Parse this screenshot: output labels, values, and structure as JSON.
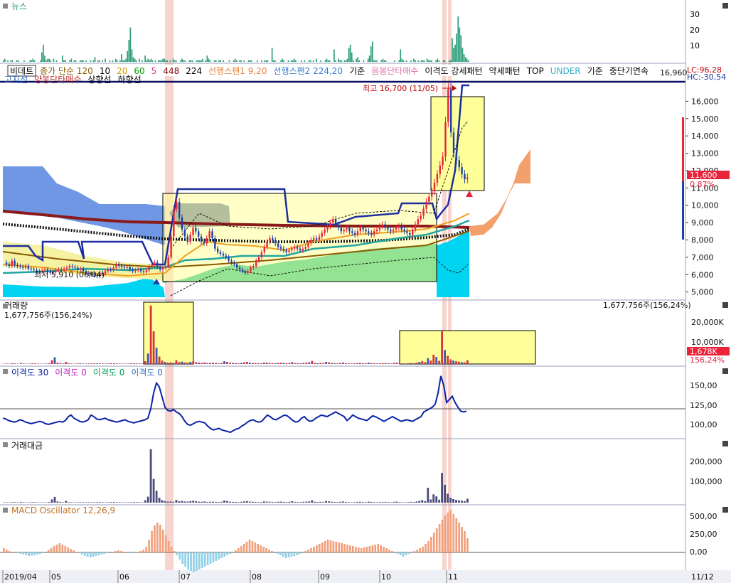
{
  "colors": {
    "up": "#e8233a",
    "down": "#1e3fa8",
    "news": "#2e9e7a",
    "volume_up": "#d93240",
    "volume_down": "#3a58b8",
    "disparity": "#0b23a6",
    "value": "#4b4b7c",
    "macd_pos": "#f2a07c",
    "macd_neg": "#8fd0e8",
    "highlight": "#f6c6bd",
    "box": "#ffff99",
    "cloud_blue": "#6f97e3",
    "cloud_orange": "#f4a06c",
    "cyan": "#00d4f0",
    "green": "#12c08a"
  },
  "x_axis": {
    "labels": [
      "2019/04",
      "05",
      "06",
      "07",
      "08",
      "09",
      "10",
      "11"
    ],
    "right_label": "11/12"
  },
  "news_panel": {
    "title": "뉴스",
    "y_ticks": [
      "30",
      "20",
      "10"
    ],
    "values": [
      1,
      2,
      0,
      1,
      0,
      1,
      1,
      0,
      0,
      1,
      1,
      0,
      0,
      0,
      1,
      0,
      0,
      0,
      1,
      1,
      2,
      1,
      0,
      0,
      0,
      1,
      6,
      11,
      4,
      1,
      2,
      2,
      1,
      0,
      2,
      0,
      1,
      0,
      0,
      0,
      4,
      1,
      1,
      0,
      0,
      1,
      2,
      0,
      1,
      1,
      0,
      0,
      1,
      1,
      1,
      0,
      1,
      0,
      0,
      1,
      0,
      1,
      3,
      0,
      1,
      1,
      0,
      1,
      0,
      2,
      0,
      0,
      1,
      0,
      1,
      0,
      2,
      1,
      0,
      1,
      5,
      1,
      1,
      2,
      7,
      14,
      22,
      8,
      3,
      2,
      1,
      0,
      2,
      0,
      1,
      0,
      4,
      1,
      2,
      1,
      2,
      1,
      0,
      1,
      0,
      1,
      1,
      1,
      2,
      2,
      1,
      1,
      0,
      1,
      0,
      2,
      1,
      1,
      0,
      0,
      1,
      2,
      1,
      1,
      0,
      0,
      1,
      1,
      1,
      0,
      0,
      1,
      1,
      1,
      1,
      2,
      0,
      1,
      4,
      2,
      1,
      0,
      0,
      1,
      1,
      0,
      1,
      1,
      0,
      1,
      0,
      0,
      0,
      1,
      0,
      0,
      1,
      2,
      1,
      0,
      1,
      1,
      0,
      1,
      0,
      0,
      1,
      1,
      1,
      0,
      0,
      0,
      1,
      0,
      0,
      1,
      0,
      1,
      1,
      1,
      0,
      0,
      9,
      1,
      1,
      0,
      0,
      0,
      1,
      2,
      1,
      0,
      0,
      1,
      0,
      1,
      1,
      2,
      1,
      0,
      0,
      0,
      1,
      0,
      1,
      0,
      0,
      1,
      1,
      0,
      1,
      0,
      2,
      0,
      0,
      1,
      0,
      0,
      1,
      2,
      1,
      1,
      0,
      0,
      8,
      1,
      0,
      2,
      1,
      1,
      0,
      1,
      1,
      2,
      9,
      11,
      6,
      1,
      0,
      2,
      3,
      1,
      0,
      0,
      1,
      0,
      0,
      2,
      4,
      10,
      13,
      1,
      1,
      1,
      0,
      0,
      1,
      2,
      1,
      1,
      0,
      0,
      0,
      0,
      0,
      1,
      0,
      0,
      1,
      8,
      2,
      1,
      0,
      1,
      0,
      0,
      1,
      0,
      2,
      1,
      0,
      1,
      0,
      1,
      1,
      1,
      0,
      2,
      1,
      1,
      1,
      0,
      0,
      1,
      2,
      1,
      0,
      0,
      1,
      1,
      0,
      0,
      1,
      1,
      15,
      9,
      11,
      18,
      29,
      22,
      17,
      9,
      5,
      3,
      2,
      1
    ]
  },
  "price_panel": {
    "legend_row1": [
      {
        "text": "비데트",
        "color": "#000000"
      },
      {
        "text": "종가 단순 120",
        "color": "#8b5a00"
      },
      {
        "text": "10",
        "color": "#000000"
      },
      {
        "text": "20",
        "color": "#d2a000"
      },
      {
        "text": "60",
        "color": "#00a000"
      },
      {
        "text": "5",
        "color": "#d43a8a"
      },
      {
        "text": "448",
        "color": "#8b0000"
      },
      {
        "text": "224",
        "color": "#000000"
      },
      {
        "text": "선행스팬1 9,20",
        "color": "#e8833a"
      },
      {
        "text": "선행스팬2 224,20",
        "color": "#3a7ad0"
      },
      {
        "text": "기준",
        "color": "#000000"
      },
      {
        "text": "음봉단타매수",
        "color": "#e06ca6"
      },
      {
        "text": "이격도 강세패턴",
        "color": "#000000"
      },
      {
        "text": "약세패턴",
        "color": "#000000"
      },
      {
        "text": "TOP",
        "color": "#000000"
      },
      {
        "text": "UNDER",
        "color": "#30b0d0"
      },
      {
        "text": "기준",
        "color": "#000000"
      },
      {
        "text": "중단기연속",
        "color": "#000000"
      }
    ],
    "legend_row2": [
      {
        "text": "고지선",
        "color": "#2e6bc0"
      },
      {
        "text": "양봉단타매수",
        "color": "#c03030"
      },
      {
        "text": "상향선",
        "color": "#000000"
      },
      {
        "text": "하향선",
        "color": "#000000"
      }
    ],
    "lc": "LC:96,28",
    "hc": "HC:-30,54",
    "top_right_value": "16,960",
    "y_ticks": [
      "16,000",
      "15,000",
      "14,000",
      "13,000",
      "12,000",
      "11,000",
      "10,000",
      "9,000",
      "8,000",
      "7,000",
      "6,000",
      "5,000"
    ],
    "current_price": "11,600",
    "current_change": "0,87%",
    "high_annotation": "최고 16,700 (11/05)",
    "low_annotation": "최저 5,910 (06/04)"
  },
  "volume_panel": {
    "title": "거래량",
    "subtitle": "1,677,756주(156,24%)",
    "right_text": "1,677,756주(156,24%)",
    "y_ticks": [
      "20,000K",
      "10,000K"
    ],
    "current_value": "1,678K",
    "current_pct": "156,24%"
  },
  "disparity_panel": {
    "legend": [
      {
        "text": "이격도 30",
        "color": "#0b23a6"
      },
      {
        "text": "이격도 0",
        "color": "#c020c0"
      },
      {
        "text": "이격도 0",
        "color": "#00a060"
      },
      {
        "text": "이격도 0",
        "color": "#3070c0"
      }
    ],
    "y_ticks": [
      "150,00",
      "125,00",
      "100,00"
    ]
  },
  "value_panel": {
    "title": "거래대금",
    "y_ticks": [
      "200,000",
      "100,000"
    ]
  },
  "macd_panel": {
    "title": "MACD Oscillator 12,26,9",
    "y_ticks": [
      "500,00",
      "250,00",
      "0,00"
    ]
  },
  "chart_data": [
    {
      "type": "candlestick",
      "title": "비데트",
      "x_range": [
        "2019/04",
        "11/12"
      ],
      "y_range": [
        4700,
        17000
      ],
      "y_ticks": [
        5000,
        6000,
        7000,
        8000,
        9000,
        10000,
        11000,
        12000,
        13000,
        14000,
        15000,
        16000
      ],
      "last_close": 11600,
      "change_pct": 0.87,
      "high": {
        "value": 16700,
        "date": "11/05"
      },
      "low": {
        "value": 5910,
        "date": "06/04"
      },
      "close_path": [
        6700,
        6600,
        6500,
        6800,
        6550,
        6500,
        6450,
        6400,
        6500,
        6350,
        6300,
        6250,
        6200,
        6180,
        6250,
        6300,
        6200,
        6100,
        6150,
        6250,
        6300,
        6250,
        6350,
        6400,
        6500,
        6450,
        6400,
        6300,
        6350,
        6200,
        6100,
        6050,
        6000,
        5950,
        5910,
        6100,
        6050,
        6200,
        6300,
        6250,
        6400,
        6600,
        6500,
        6450,
        6400,
        6450,
        6300,
        6200,
        6250,
        6300,
        6200,
        6150,
        6250,
        6500,
        6600,
        6700,
        6450,
        6300,
        6400,
        6500,
        7000,
        8200,
        9800,
        10200,
        9300,
        8600,
        8200,
        7900,
        8300,
        8700,
        8500,
        8200,
        7900,
        7800,
        8100,
        8500,
        8100,
        7500,
        7300,
        7200,
        7100,
        7000,
        6800,
        6700,
        6600,
        6400,
        6300,
        6200,
        6100,
        6200,
        6400,
        6500,
        6800,
        7000,
        7300,
        7600,
        7900,
        8100,
        8000,
        7800,
        7600,
        7500,
        7400,
        7300,
        7400,
        7500,
        7600,
        7500,
        7400,
        7500,
        7600,
        7800,
        8000,
        8100,
        8000,
        8200,
        8400,
        8600,
        8800,
        9000,
        9200,
        8900,
        8700,
        8500,
        8600,
        8700,
        8500,
        8400,
        8300,
        8500,
        8700,
        8600,
        8500,
        8400,
        8300,
        8500,
        8600,
        8800,
        8900,
        8700,
        8600,
        8500,
        8600,
        8700,
        8800,
        8600,
        8500,
        8400,
        8300,
        8600,
        8900,
        9200,
        9400,
        9800,
        10200,
        10500,
        10800,
        11300,
        11800,
        12300,
        12800,
        14800,
        16700,
        14200,
        13000,
        12600,
        12200,
        11800,
        11500,
        11600
      ]
    },
    {
      "type": "bar",
      "title": "거래량",
      "y_ticks": [
        10000,
        20000
      ],
      "y_unit": "K",
      "last_value": 1677756,
      "last_pct": 156.24,
      "values": [
        150,
        200,
        120,
        300,
        250,
        180,
        400,
        220,
        160,
        140,
        300,
        260,
        180,
        150,
        120,
        200,
        350,
        1600,
        2900,
        600,
        380,
        250,
        900,
        300,
        200,
        150,
        260,
        300,
        200,
        180,
        250,
        200,
        260,
        300,
        280,
        220,
        180,
        240,
        300,
        350,
        260,
        200,
        150,
        180,
        220,
        260,
        300,
        250,
        200,
        180,
        1200,
        4500,
        25000,
        14000,
        7000,
        3200,
        1500,
        900,
        600,
        700,
        500,
        1600,
        800,
        1000,
        700,
        600,
        900,
        1200,
        800,
        600,
        500,
        700,
        400,
        500,
        600,
        400,
        300,
        500,
        1200,
        900,
        600,
        450,
        400,
        300,
        500,
        700,
        900,
        600,
        500,
        400,
        350,
        300,
        700,
        600,
        500,
        400,
        300,
        500,
        600,
        450,
        350,
        500,
        800,
        400,
        350,
        300,
        500,
        600,
        700,
        1300,
        500,
        350,
        450,
        400,
        900,
        700,
        500,
        350,
        300,
        500,
        650,
        400,
        300,
        200,
        300,
        400,
        500,
        350,
        300,
        600,
        400,
        300,
        250,
        300,
        350,
        400,
        300,
        250,
        450,
        600,
        300,
        250,
        200,
        300,
        400,
        350,
        600,
        900,
        1300,
        800,
        2500,
        1500,
        4000,
        3000,
        1400,
        14000,
        6000,
        3500,
        2000,
        1500,
        1200,
        1000,
        800,
        700,
        1678
      ]
    },
    {
      "type": "line",
      "title": "이격도 30",
      "y_ticks": [
        100,
        125,
        150
      ],
      "reference_line": 120,
      "values": [
        108,
        107,
        105,
        104,
        103,
        104,
        106,
        105,
        103,
        102,
        101,
        102,
        103,
        104,
        103,
        101,
        100,
        101,
        102,
        103,
        104,
        103,
        105,
        110,
        112,
        108,
        106,
        104,
        103,
        104,
        106,
        112,
        110,
        107,
        106,
        107,
        108,
        106,
        105,
        104,
        103,
        104,
        105,
        106,
        104,
        103,
        102,
        103,
        104,
        105,
        106,
        108,
        120,
        140,
        153,
        148,
        135,
        122,
        118,
        117,
        119,
        116,
        114,
        110,
        104,
        100,
        99,
        101,
        103,
        104,
        103,
        102,
        98,
        95,
        93,
        94,
        95,
        93,
        92,
        91,
        90,
        92,
        94,
        95,
        98,
        100,
        103,
        105,
        106,
        104,
        103,
        104,
        108,
        112,
        110,
        107,
        106,
        108,
        110,
        112,
        111,
        108,
        105,
        103,
        104,
        108,
        110,
        106,
        104,
        105,
        108,
        110,
        112,
        111,
        110,
        112,
        114,
        116,
        114,
        112,
        110,
        105,
        108,
        112,
        110,
        108,
        107,
        106,
        105,
        108,
        111,
        110,
        108,
        106,
        104,
        106,
        108,
        110,
        108,
        106,
        104,
        105,
        106,
        105,
        104,
        106,
        108,
        110,
        116,
        118,
        120,
        122,
        126,
        140,
        162,
        150,
        128,
        132,
        136,
        128,
        122,
        117,
        116,
        117
      ]
    },
    {
      "type": "bar",
      "title": "거래대금",
      "y_ticks": [
        100000,
        200000
      ],
      "values": [
        1500,
        2000,
        1200,
        3000,
        2500,
        1800,
        4000,
        2200,
        1600,
        1400,
        3000,
        2600,
        1800,
        1500,
        1200,
        2000,
        3500,
        16000,
        29000,
        6000,
        3800,
        2500,
        9000,
        3000,
        2000,
        1500,
        2600,
        3000,
        2000,
        1800,
        2500,
        2000,
        2600,
        3000,
        2800,
        2200,
        1800,
        2400,
        3000,
        3500,
        2600,
        2000,
        1500,
        1800,
        2200,
        2600,
        3000,
        2500,
        2000,
        1800,
        12000,
        30000,
        270000,
        120000,
        60000,
        25000,
        13000,
        8000,
        5500,
        6000,
        4500,
        14000,
        7000,
        9000,
        6000,
        5500,
        8000,
        10000,
        7000,
        5000,
        4500,
        6000,
        3500,
        4500,
        5000,
        3500,
        2800,
        4500,
        11000,
        8000,
        5000,
        4000,
        3500,
        2800,
        4500,
        6500,
        8000,
        5500,
        4500,
        3500,
        3000,
        2800,
        6500,
        5500,
        4500,
        3500,
        2800,
        4500,
        5500,
        4000,
        3200,
        4500,
        7500,
        3800,
        3200,
        2800,
        4800,
        5500,
        6500,
        12000,
        4500,
        3200,
        4200,
        3800,
        8500,
        6500,
        4500,
        3200,
        2800,
        4500,
        6000,
        3800,
        2800,
        1800,
        2800,
        3800,
        4500,
        3200,
        2800,
        5500,
        3800,
        2800,
        2200,
        2800,
        3200,
        3800,
        2800,
        2200,
        4200,
        5500,
        2800,
        2200,
        1800,
        2800,
        3800,
        3200,
        6000,
        9000,
        13000,
        8000,
        75000,
        16000,
        42000,
        32000,
        15000,
        150000,
        90000,
        45000,
        25000,
        18000,
        14000,
        12000,
        10000,
        8000,
        20000
      ]
    },
    {
      "type": "bar",
      "title": "MACD Oscillator 12,26,9",
      "y_ticks": [
        0,
        250,
        500
      ],
      "values": [
        60,
        40,
        20,
        10,
        0,
        -10,
        -20,
        -30,
        -40,
        -50,
        -45,
        -40,
        -30,
        -20,
        -10,
        10,
        30,
        60,
        90,
        110,
        130,
        110,
        90,
        70,
        50,
        30,
        10,
        -10,
        -30,
        -50,
        -60,
        -70,
        -60,
        -50,
        -40,
        -30,
        -20,
        -10,
        0,
        10,
        20,
        30,
        20,
        10,
        0,
        -10,
        -10,
        0,
        10,
        20,
        40,
        80,
        180,
        300,
        380,
        420,
        390,
        320,
        240,
        160,
        80,
        20,
        -40,
        -100,
        -160,
        -200,
        -240,
        -260,
        -280,
        -260,
        -240,
        -220,
        -200,
        -180,
        -160,
        -140,
        -120,
        -100,
        -80,
        -60,
        -40,
        -20,
        0,
        30,
        60,
        90,
        120,
        150,
        180,
        160,
        140,
        120,
        100,
        80,
        60,
        40,
        20,
        0,
        -20,
        -40,
        -60,
        -80,
        -70,
        -60,
        -50,
        -40,
        -20,
        0,
        20,
        40,
        60,
        80,
        100,
        120,
        140,
        160,
        180,
        170,
        160,
        150,
        140,
        130,
        120,
        110,
        100,
        90,
        80,
        70,
        60,
        70,
        80,
        90,
        100,
        110,
        120,
        100,
        80,
        60,
        40,
        20,
        0,
        -20,
        -40,
        -60,
        -40,
        -20,
        0,
        20,
        40,
        60,
        80,
        120,
        160,
        220,
        280,
        340,
        400,
        460,
        520,
        560,
        600,
        540,
        480,
        420,
        360,
        300,
        200
      ]
    }
  ]
}
